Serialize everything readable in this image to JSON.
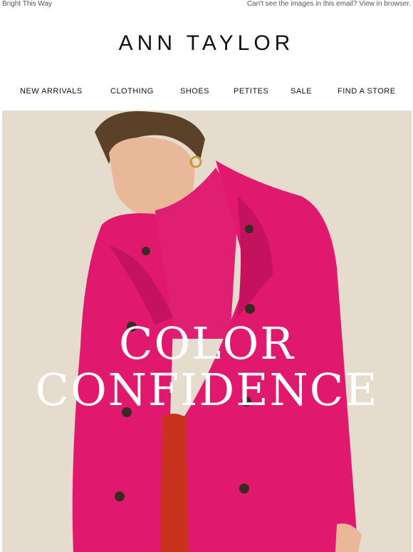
{
  "preheader": {
    "subject": "Bright This Way",
    "view_in_browser": "Can't see the images in this email? View in browser."
  },
  "brand": {
    "logo": "ANN TAYLOR"
  },
  "nav": [
    {
      "label": "NEW ARRIVALS"
    },
    {
      "label": "CLOTHING"
    },
    {
      "label": "SHOES"
    },
    {
      "label": "PETITES"
    },
    {
      "label": "SALE"
    },
    {
      "label": "FIND A STORE"
    }
  ],
  "hero": {
    "headline_line1": "COLOR",
    "headline_line2": "CONFIDENCE",
    "coat_color": "#e0196f",
    "background_color": "#e6dccd"
  }
}
